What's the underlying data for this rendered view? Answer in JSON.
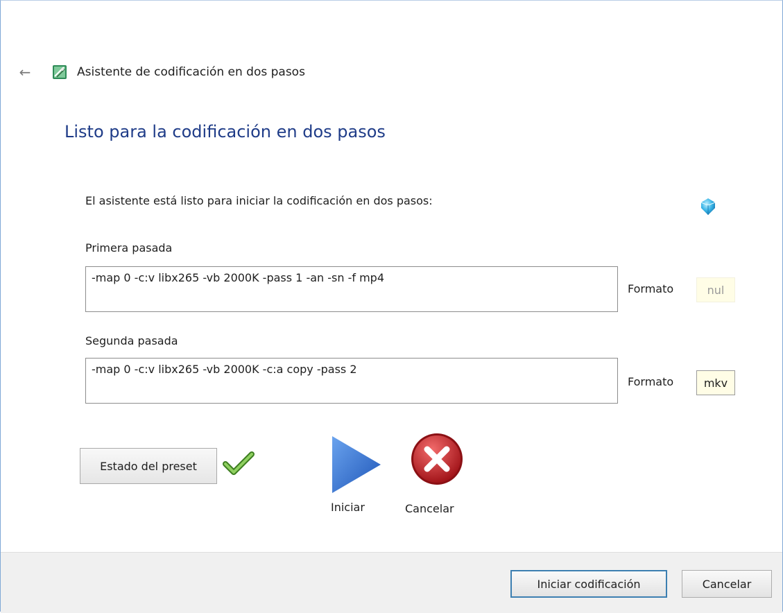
{
  "window": {
    "title": "Asistente de codificación en dos pasos",
    "back_icon": "back-arrow-icon",
    "app_icon": "wizard-app-icon"
  },
  "page": {
    "heading": "Listo para la codificación en dos pasos",
    "intro": "El asistente está listo para iniciar la codificación en dos pasos:",
    "info_icon": "info-gem-icon"
  },
  "first_pass": {
    "label": "Primera pasada",
    "command": "-map 0 -c:v libx265 -vb 2000K  -pass 1 -an -sn -f mp4",
    "format_label": "Formato",
    "format_value": "nul"
  },
  "second_pass": {
    "label": "Segunda pasada",
    "command": "-map 0 -c:v libx265 -vb 2000K -c:a copy -pass 2",
    "format_label": "Formato",
    "format_value": "mkv"
  },
  "actions": {
    "preset_button": "Estado del preset",
    "preset_status_icon": "checkmark-icon",
    "start_label": "Iniciar",
    "cancel_label": "Cancelar"
  },
  "footer": {
    "start_button": "Iniciar codificación",
    "cancel_button": "Cancelar"
  },
  "colors": {
    "heading": "#1f3c88",
    "play": "#2f6fd0",
    "cancel": "#c8262a",
    "check": "#5aa02c",
    "primary_border": "#3c7fb1"
  }
}
